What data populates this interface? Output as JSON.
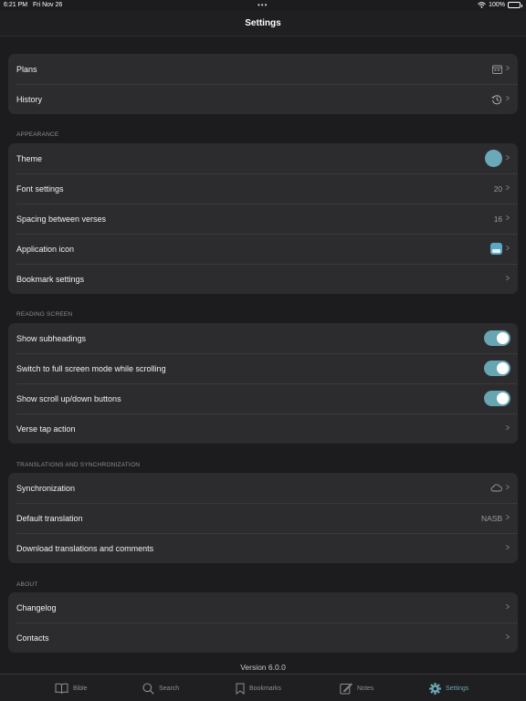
{
  "status_bar": {
    "time": "6:21 PM",
    "date": "Fri Nov 26",
    "battery": "100%",
    "battery_level": 1.0
  },
  "nav": {
    "title": "Settings"
  },
  "top_group": {
    "plans_label": "Plans",
    "history_label": "History"
  },
  "appearance": {
    "header": "APPEARANCE",
    "theme_label": "Theme",
    "theme_color": "#6aa9b8",
    "font_label": "Font settings",
    "font_value": "20",
    "spacing_label": "Spacing between verses",
    "spacing_value": "16",
    "app_icon_label": "Application icon",
    "bookmark_label": "Bookmark settings"
  },
  "reading": {
    "header": "READING SCREEN",
    "subheadings_label": "Show subheadings",
    "subheadings_on": true,
    "fullscreen_label": "Switch to full screen mode while scrolling",
    "fullscreen_on": true,
    "scroll_buttons_label": "Show scroll up/down buttons",
    "scroll_buttons_on": true,
    "verse_tap_label": "Verse tap action"
  },
  "translations": {
    "header": "TRANSLATIONS AND SYNCHRONIZATION",
    "sync_label": "Synchronization",
    "default_label": "Default translation",
    "default_value": "NASB",
    "download_label": "Download translations and comments"
  },
  "about": {
    "header": "ABOUT",
    "changelog_label": "Changelog",
    "contacts_label": "Contacts"
  },
  "version": "Version 6.0.0",
  "tabs": {
    "bible": "Bible",
    "search": "Search",
    "bookmarks": "Bookmarks",
    "notes": "Notes",
    "settings": "Settings",
    "active": "settings",
    "accent_color": "#68a5b3"
  },
  "icons": {
    "plans": "calendar-icon",
    "history": "history-clock-icon",
    "sync": "cloud-icon",
    "chevron": "chevron-right-icon"
  }
}
